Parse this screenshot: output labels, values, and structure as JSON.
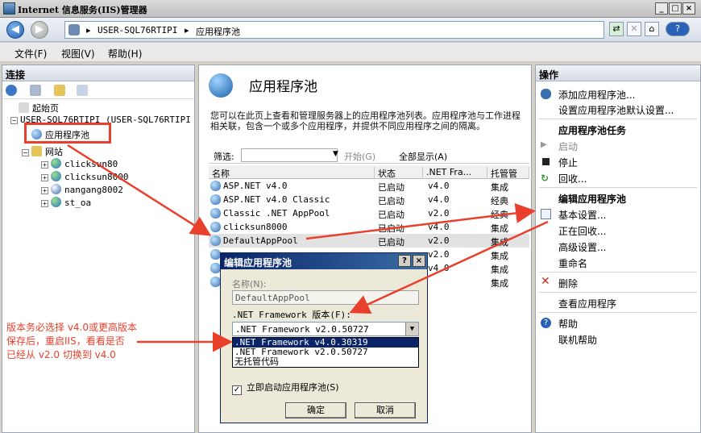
{
  "window": {
    "title": "Internet 信息服务(IIS)管理器",
    "minimize": "_",
    "maximize": "□",
    "close": "×"
  },
  "address": {
    "back": "◀",
    "forward": "▶",
    "sep": "▸",
    "crumbs": [
      "USER-SQL76RTIPI",
      "应用程序池"
    ],
    "help": "?"
  },
  "menu": [
    "文件(F)",
    "视图(V)",
    "帮助(H)"
  ],
  "connections": {
    "header": "连接",
    "tree": {
      "start_page": "起始页",
      "server": "USER-SQL76RTIPI (USER-SQL76RTIPI",
      "app_pools": "应用程序池",
      "sites": "网站",
      "site_items": [
        "clicksun80",
        "clicksun8000",
        "nangang8002",
        "st_oa"
      ]
    }
  },
  "main": {
    "title": "应用程序池",
    "description": "您可以在此页上查看和管理服务器上的应用程序池列表。应用程序池与工作进程相关联，包含一个或多个应用程序，并提供不同应用程序之间的隔离。",
    "filter": {
      "label": "筛选:",
      "go": "开始(G)",
      "show_all": "全部显示(A)"
    },
    "columns": [
      "名称",
      "状态",
      ".NET Fra...",
      "托管管"
    ],
    "rows": [
      {
        "name": "ASP.NET v4.0",
        "status": "已启动",
        "net": "v4.0",
        "mode": "集成"
      },
      {
        "name": "ASP.NET v4.0 Classic",
        "status": "已启动",
        "net": "v4.0",
        "mode": "经典"
      },
      {
        "name": "Classic .NET AppPool",
        "status": "已启动",
        "net": "v2.0",
        "mode": "经典"
      },
      {
        "name": "clicksun8000",
        "status": "已启动",
        "net": "v4.0",
        "mode": "集成"
      },
      {
        "name": "DefaultAppPool",
        "status": "已启动",
        "net": "v2.0",
        "mode": "集成"
      },
      {
        "name": "",
        "status": "",
        "net": "v2.0",
        "mode": "集成"
      },
      {
        "name": "",
        "status": "",
        "net": "v4.0",
        "mode": "集成"
      },
      {
        "name": "",
        "status": "",
        "net": "",
        "mode": "集成"
      }
    ]
  },
  "actions": {
    "header": "操作",
    "add_pool": "添加应用程序池...",
    "set_defaults": "设置应用程序池默认设置...",
    "tasks_header": "应用程序池任务",
    "start": "启动",
    "stop": "停止",
    "recycle": "回收...",
    "edit_header": "编辑应用程序池",
    "basic": "基本设置...",
    "recycling": "正在回收...",
    "advanced": "高级设置...",
    "rename": "重命名",
    "delete": "删除",
    "view_apps": "查看应用程序",
    "help": "帮助",
    "online_help": "联机帮助"
  },
  "dialog": {
    "title": "编辑应用程序池",
    "help_btn": "?",
    "close_btn": "×",
    "name_label": "名称(N):",
    "name_value": "DefaultAppPool",
    "framework_label": ".NET Framework 版本(F):",
    "framework_selected": ".NET Framework v2.0.50727",
    "options": [
      ".NET Framework v4.0.30319",
      ".NET Framework v2.0.50727",
      "无托管代码"
    ],
    "autostart": "立即启动应用程序池(S)",
    "ok": "确定",
    "cancel": "取消"
  },
  "annotation": {
    "lines": [
      "版本务必选择 v4.0或更高版本",
      "保存后，重启IIS，看看是否",
      "已经从 v2.0 切换到 v4.0"
    ]
  }
}
